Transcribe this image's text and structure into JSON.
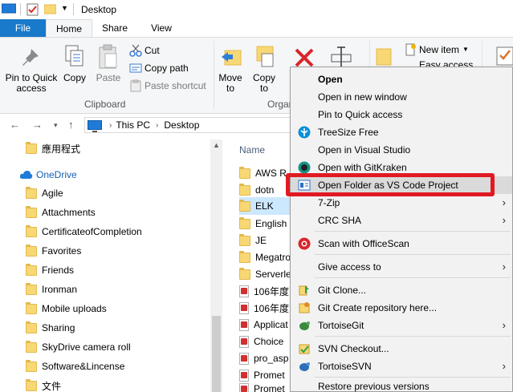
{
  "window": {
    "title": "Desktop"
  },
  "tabs": [
    "File",
    "Home",
    "Share",
    "View"
  ],
  "ribbon": {
    "pin_label": "Pin to Quick\naccess",
    "copy_label": "Copy",
    "paste_label": "Paste",
    "cut_label": "Cut",
    "copy_path_label": "Copy path",
    "paste_shortcut_label": "Paste shortcut",
    "clipboard_group": "Clipboard",
    "move_to_label": "Move\nto",
    "copy_to_label": "Copy\nto",
    "organize_group": "Organ",
    "new_item_label": "New item",
    "easy_access_label": "Easy access"
  },
  "address": {
    "crumbs": [
      "This PC",
      "Desktop"
    ]
  },
  "navpane": {
    "items": [
      "應用程式",
      "OneDrive",
      "Agile",
      "Attachments",
      "CertificateofCompletion",
      "Favorites",
      "Friends",
      "Ironman",
      "Mobile uploads",
      "Sharing",
      "SkyDrive camera roll",
      "Software&Lincense",
      "文件"
    ]
  },
  "filelist": {
    "column_name": "Name",
    "files": [
      "AWS R",
      "dotn",
      "ELK",
      "English",
      "JE",
      "Megatro",
      "Serverle",
      "106年度",
      "106年度",
      "Applicat",
      "Choice",
      "pro_asp",
      "Promet",
      "Promet"
    ]
  },
  "context_menu": {
    "items": [
      "Open",
      "Open in new window",
      "Pin to Quick access",
      "TreeSize Free",
      "Open in Visual Studio",
      "Open with GitKraken",
      "Open Folder as VS Code Project",
      "7-Zip",
      "CRC SHA",
      "Scan with OfficeScan",
      "Give access to",
      "Git Clone...",
      "Git Create repository here...",
      "TortoiseGit",
      "SVN Checkout...",
      "TortoiseSVN",
      "Restore previous versions"
    ]
  },
  "colors": {
    "file_tab": "#1979ca",
    "highlight": "#e11a22",
    "selection": "#cce8ff"
  }
}
